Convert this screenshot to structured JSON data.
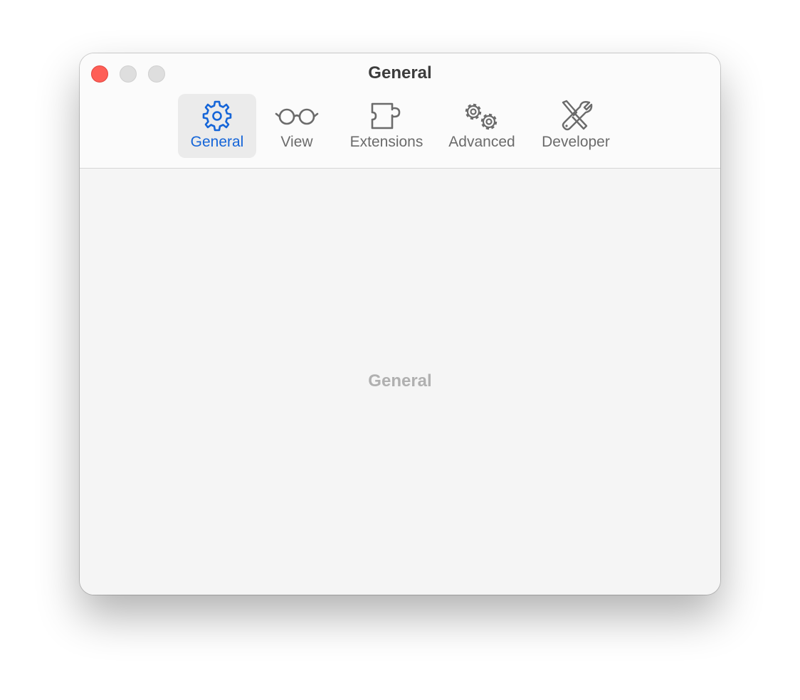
{
  "window": {
    "title": "General",
    "traffic_lights": [
      "close",
      "minimize",
      "zoom"
    ]
  },
  "toolbar": {
    "selected_tab": "General",
    "tabs": [
      {
        "label": "General",
        "icon": "gear-icon"
      },
      {
        "label": "View",
        "icon": "glasses-icon"
      },
      {
        "label": "Extensions",
        "icon": "puzzle-piece-icon"
      },
      {
        "label": "Advanced",
        "icon": "gears-icon"
      },
      {
        "label": "Developer",
        "icon": "wrench-screwdriver-icon"
      }
    ]
  },
  "content": {
    "placeholder": "General"
  },
  "colors": {
    "accent": "#1565d8",
    "close_button": "#fe5f57",
    "inactive_button": "#dedede",
    "tab_label": "#6b6b6b",
    "placeholder_text": "#b0b0b0"
  }
}
